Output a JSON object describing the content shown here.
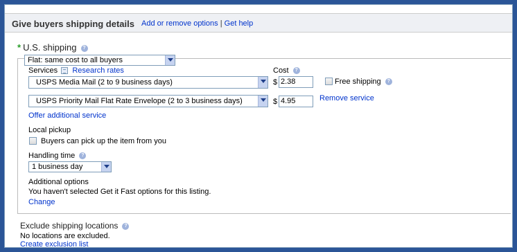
{
  "header": {
    "title": "Give buyers shipping details",
    "add_remove_link": "Add or remove options",
    "separator": "|",
    "help_link": "Get help"
  },
  "us_shipping": {
    "required_marker": "*",
    "title": "U.S. shipping",
    "type_select": "Flat: same cost to all buyers",
    "services_label": "Services",
    "research_rates_link": "Research rates",
    "cost_label": "Cost",
    "services": [
      {
        "name": "USPS Media Mail  (2 to 9 business days)",
        "currency": "$",
        "cost": "2.38"
      },
      {
        "name": "USPS Priority Mail Flat Rate Envelope  (2 to 3 business days)",
        "currency": "$",
        "cost": "4.95"
      }
    ],
    "free_shipping_label": "Free shipping",
    "free_shipping_checked": false,
    "remove_service_link": "Remove service",
    "offer_additional_link": "Offer additional service",
    "local_pickup_label": "Local pickup",
    "local_pickup_checkbox_label": "Buyers can pick up the item from you",
    "local_pickup_checked": false,
    "handling_time_label": "Handling time",
    "handling_time_select": "1 business day",
    "additional_options_label": "Additional options",
    "additional_options_text": "You haven't selected Get it Fast options for this listing.",
    "change_link": "Change"
  },
  "exclude": {
    "title": "Exclude shipping locations",
    "status_text": "No locations are excluded.",
    "create_link": "Create exclusion list"
  },
  "colors": {
    "outer_border": "#2b5597",
    "header_bg": "#eef0f4",
    "link": "#0033cc",
    "required_star": "#2a9d2a"
  },
  "icons": {
    "help": "question-circle-icon",
    "select_arrow": "chevron-down-icon",
    "services_table": "grid-icon"
  }
}
